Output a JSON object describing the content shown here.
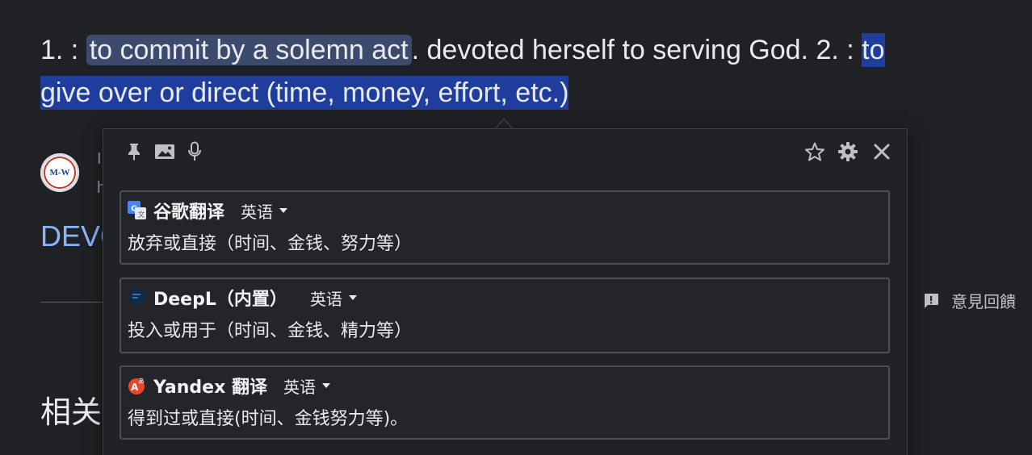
{
  "definition": {
    "prefix": "1. : ",
    "sense1_highlight": "to commit by a solemn act",
    "middle": ". devoted herself to serving God. 2. : ",
    "sense2_highlight_line1": "to",
    "sense2_highlight_line2": "give over or direct (time, money, effort, etc.)"
  },
  "background": {
    "logo_text": "M-W",
    "peek_line1": "I",
    "peek_line2": "h",
    "dev_link": "DEVO",
    "related_heading": "相关",
    "feedback_label": "意見回饋",
    "feedback_icon": "feedback-icon"
  },
  "popup": {
    "toolbar": {
      "left_icons": [
        "pin-icon",
        "image-icon",
        "microphone-icon"
      ],
      "right_icons": [
        "star-icon",
        "gear-icon",
        "close-icon"
      ]
    },
    "results": [
      {
        "engine": "谷歌翻译",
        "icon": "google-translate-icon",
        "lang": "英语",
        "text": "放弃或直接（时间、金钱、努力等）"
      },
      {
        "engine": "DeepL（内置）",
        "icon": "deepl-icon",
        "lang": "英语",
        "text": "投入或用于（时间、金钱、精力等）"
      },
      {
        "engine": "Yandex 翻译",
        "icon": "yandex-icon",
        "lang": "英语",
        "text": "得到过或直接(时间、金钱努力等)。"
      }
    ]
  },
  "colors": {
    "page_bg": "#202124",
    "highlight_soft": "#3c4a6e",
    "highlight_strong": "#1f3d9c",
    "link": "#8ab4f8",
    "popup_bg": "#202226",
    "card_border": "#4a4e55"
  }
}
